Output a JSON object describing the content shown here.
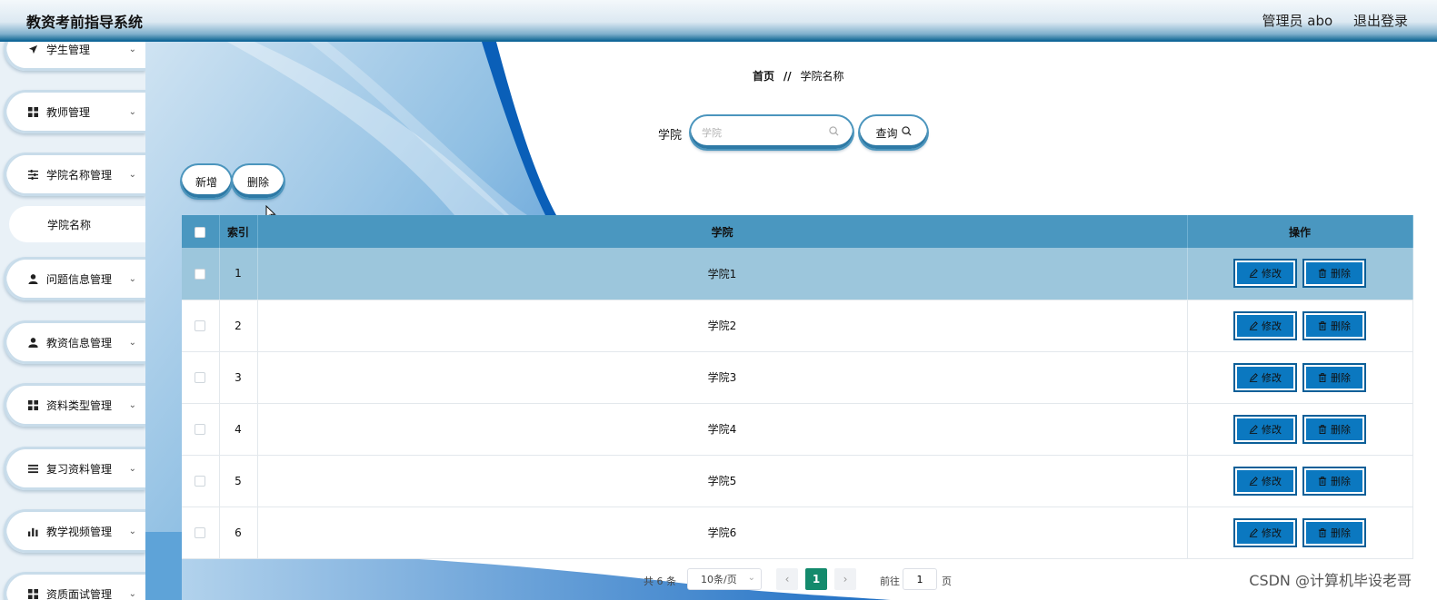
{
  "header": {
    "title": "教资考前指导系统",
    "user": "管理员 abo",
    "logout": "退出登录"
  },
  "sidebar": {
    "items": [
      {
        "label": "学生管理",
        "icon": "paper-plane-icon"
      },
      {
        "label": "教师管理",
        "icon": "grid-icon"
      },
      {
        "label": "学院名称管理",
        "icon": "sliders-icon"
      },
      {
        "label": "问题信息管理",
        "icon": "user-icon"
      },
      {
        "label": "教资信息管理",
        "icon": "user-icon"
      },
      {
        "label": "资料类型管理",
        "icon": "grid-icon"
      },
      {
        "label": "复习资料管理",
        "icon": "list-icon"
      },
      {
        "label": "教学视频管理",
        "icon": "bar-chart-icon"
      },
      {
        "label": "资质面试管理",
        "icon": "grid-icon"
      }
    ],
    "active_sub": "学院名称"
  },
  "breadcrumb": {
    "home": "首页",
    "sep": "//",
    "current": "学院名称"
  },
  "search": {
    "label": "学院",
    "placeholder": "学院",
    "button": "查询"
  },
  "toolbar": {
    "add": "新增",
    "delete": "删除"
  },
  "table": {
    "headers": [
      "索引",
      "学院",
      "操作"
    ],
    "rows": [
      {
        "index": "1",
        "name": "学院1"
      },
      {
        "index": "2",
        "name": "学院2"
      },
      {
        "index": "3",
        "name": "学院3"
      },
      {
        "index": "4",
        "name": "学院4"
      },
      {
        "index": "5",
        "name": "学院5"
      },
      {
        "index": "6",
        "name": "学院6"
      }
    ],
    "edit_label": "修改",
    "delete_label": "删除",
    "selected_row": 0
  },
  "pagination": {
    "total": "共 6 条",
    "page_size": "10条/页",
    "current_page": "1",
    "goto_label": "前往",
    "goto_value": "1",
    "page_unit": "页"
  },
  "watermark": "CSDN @计算机毕设老哥",
  "colors": {
    "header_bar": "#13689a",
    "table_header": "#4a97c0",
    "selected_row": "#9cc6dc",
    "action_button": "#0b78c0",
    "pager_current": "#138a6c"
  }
}
